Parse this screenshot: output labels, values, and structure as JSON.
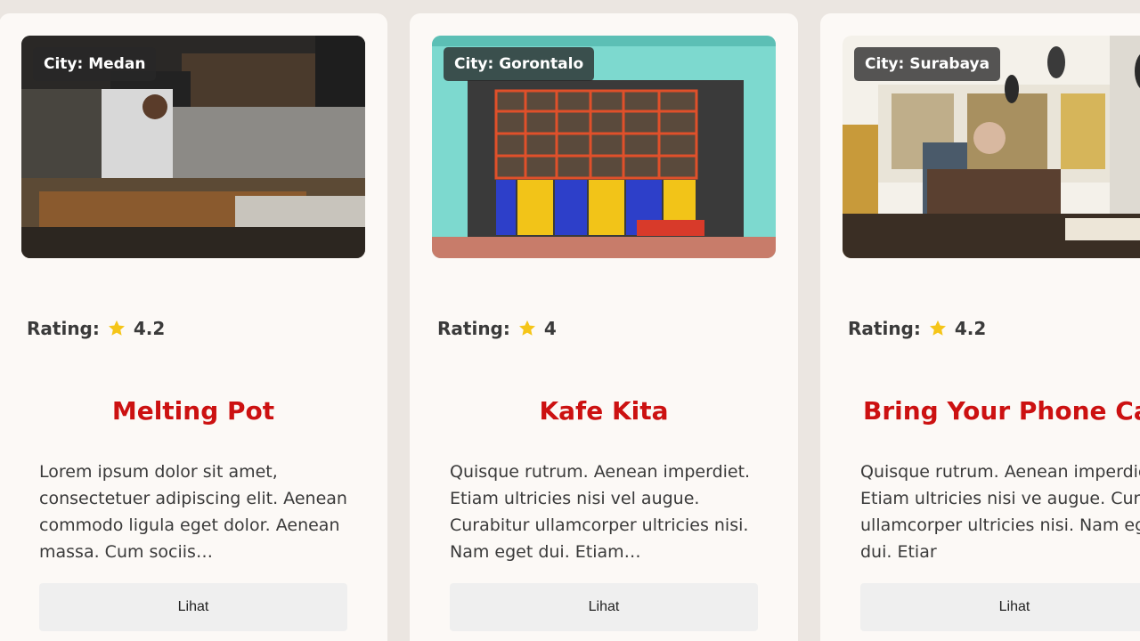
{
  "cards": [
    {
      "city_badge": "City: Medan",
      "rating_label": "Rating:",
      "rating_value": "4.2",
      "title": "Melting Pot",
      "description": "Lorem ipsum dolor sit amet, consectetuer adipiscing elit. Aenean commodo ligula eget dolor. Aenean massa. Cum sociis…",
      "button_label": "Lihat"
    },
    {
      "city_badge": "City: Gorontalo",
      "rating_label": "Rating:",
      "rating_value": "4",
      "title": "Kafe Kita",
      "description": "Quisque rutrum. Aenean imperdiet. Etiam ultricies nisi vel augue. Curabitur ullamcorper ultricies nisi. Nam eget dui. Etiam…",
      "button_label": "Lihat"
    },
    {
      "city_badge": "City: Surabaya",
      "rating_label": "Rating:",
      "rating_value": "4.2",
      "title": "Bring Your Phone Ca",
      "description": "Quisque rutrum. Aenean imperdiet. Etiam ultricies nisi ve augue. Curabitur ullamcorper ultricies nisi. Nam eget dui. Etiar",
      "button_label": "Lihat"
    }
  ],
  "colors": {
    "page_background": "#ebe6e1",
    "card_background": "#fcf9f6",
    "title_red": "#cc1111",
    "star_yellow": "#f5c518",
    "button_gray": "#efefef"
  },
  "icons": {
    "rating": "star-icon"
  }
}
